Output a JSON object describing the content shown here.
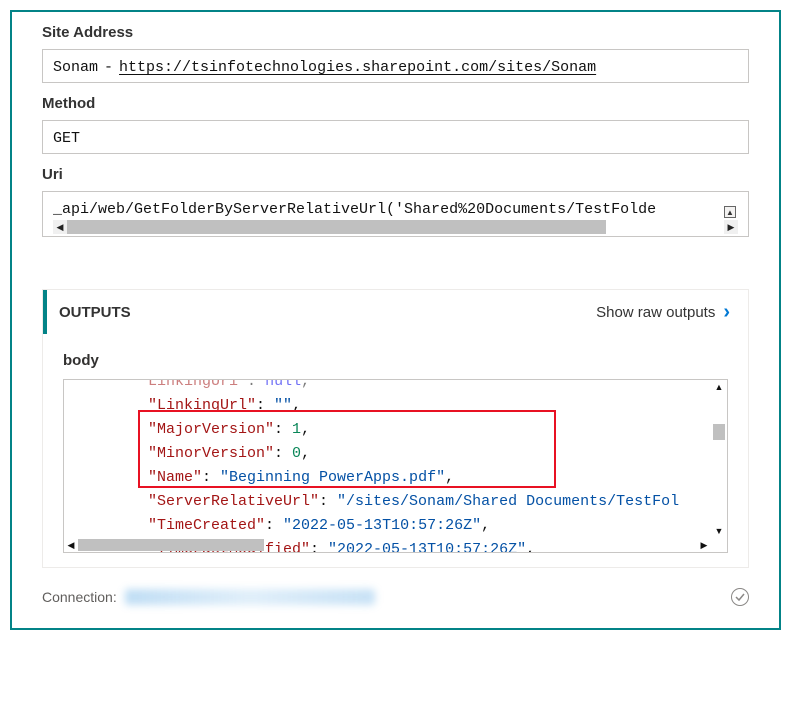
{
  "inputs": {
    "site_address_label": "Site Address",
    "site_address_prefix": "Sonam",
    "site_address_url": "https://tsinfotechnologies.sharepoint.com/sites/Sonam",
    "method_label": "Method",
    "method_value": "GET",
    "uri_label": "Uri",
    "uri_value": "_api/web/GetFolderByServerRelativeUrl('Shared%20Documents/TestFolde"
  },
  "outputs": {
    "header_title": "OUTPUTS",
    "show_raw_label": "Show raw outputs",
    "body_label": "body",
    "json": {
      "line_top_key": "LinkingUri",
      "line_top_val": "null",
      "linking_url_key": "\"LinkingUrl\"",
      "linking_url_val": "\"\"",
      "major_version_key": "\"MajorVersion\"",
      "major_version_val": "1",
      "minor_version_key": "\"MinorVersion\"",
      "minor_version_val": "0",
      "name_key": "\"Name\"",
      "name_val": "\"Beginning PowerApps.pdf\"",
      "server_rel_key": "\"ServerRelativeUrl\"",
      "server_rel_val": "\"/sites/Sonam/Shared Documents/TestFol",
      "time_created_key": "\"TimeCreated\"",
      "time_created_val": "\"2022-05-13T10:57:26Z\"",
      "time_modified_key": "\"TimeLastModified\"",
      "time_modified_val": "\"2022-05-13T10:57:26Z\""
    }
  },
  "footer": {
    "connection_label": "Connection:"
  }
}
